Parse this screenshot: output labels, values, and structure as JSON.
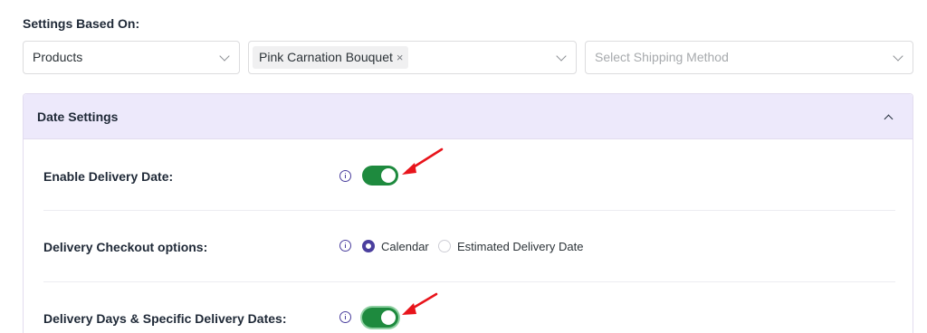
{
  "settings_based_on": {
    "label": "Settings Based On:",
    "type_select": {
      "value": "Products"
    },
    "product_select": {
      "tag": "Pink Carnation Bouquet",
      "remove_glyph": "×"
    },
    "shipping_select": {
      "placeholder": "Select Shipping Method"
    }
  },
  "date_settings": {
    "title": "Date Settings",
    "rows": [
      {
        "label": "Enable Delivery Date:",
        "toggle_on": true
      },
      {
        "label": "Delivery Checkout options:",
        "options": [
          {
            "label": "Calendar",
            "checked": true
          },
          {
            "label": "Estimated Delivery Date",
            "checked": false
          }
        ]
      },
      {
        "label": "Delivery Days & Specific Delivery Dates:",
        "toggle_on": true
      }
    ]
  },
  "annotation_color": "#e8141b",
  "accent_color": "#4b3f9e",
  "toggle_color": "#1e8a3e"
}
